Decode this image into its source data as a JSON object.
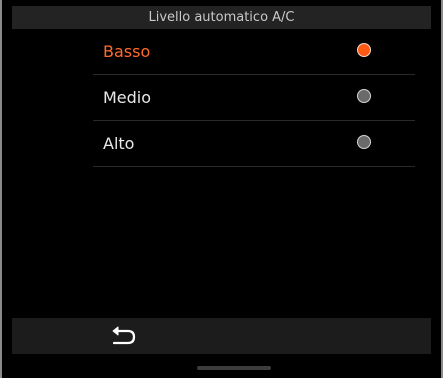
{
  "header": {
    "title": "Livello automatico A/C"
  },
  "options": [
    {
      "label": "Basso",
      "selected": true
    },
    {
      "label": "Medio",
      "selected": false
    },
    {
      "label": "Alto",
      "selected": false
    }
  ],
  "footer": {
    "back_icon": "back-arrow-icon"
  },
  "colors": {
    "accent": "#ff6a2b",
    "background": "#000000",
    "bar": "#1c1c1c"
  }
}
